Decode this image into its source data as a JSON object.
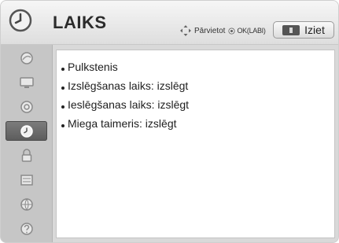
{
  "header": {
    "title": "LAIKS",
    "nav_label": "Pārvietot",
    "ok_label": "OK(LABI)",
    "exit_label": "Iziet"
  },
  "sidebar": {
    "items": [
      {
        "icon": "picture-icon",
        "active": false
      },
      {
        "icon": "screen-icon",
        "active": false
      },
      {
        "icon": "audio-icon",
        "active": false
      },
      {
        "icon": "time-icon",
        "active": true
      },
      {
        "icon": "lock-icon",
        "active": false
      },
      {
        "icon": "option-icon",
        "active": false
      },
      {
        "icon": "network-icon",
        "active": false
      },
      {
        "icon": "support-icon",
        "active": false
      }
    ]
  },
  "menu": {
    "items": [
      {
        "label": "Pulkstenis"
      },
      {
        "label": "Izslēgšanas laiks: izslēgt"
      },
      {
        "label": "Ieslēgšanas laiks: izslēgt"
      },
      {
        "label": "Miega taimeris: izslēgt"
      }
    ]
  },
  "colors": {
    "frame": "#d9d9d9",
    "sidebar": "#c6c6c6",
    "active_item": "#6a6a6a",
    "content_bg": "#ffffff"
  }
}
